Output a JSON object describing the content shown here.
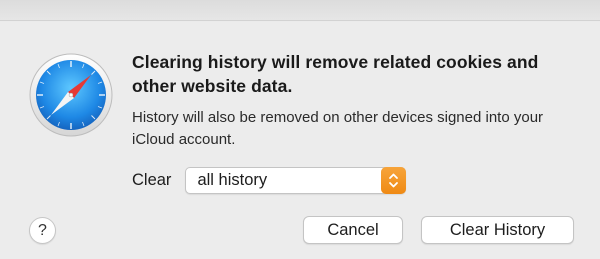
{
  "dialog": {
    "icon": "safari-compass-icon",
    "title": "Clearing history will remove related cookies and other website data.",
    "message": "History will also be removed on other devices signed into your iCloud account.",
    "clear_label": "Clear",
    "clear_select": {
      "selected": "all history"
    },
    "help_label": "?",
    "buttons": {
      "cancel": "Cancel",
      "clear_history": "Clear History"
    }
  },
  "colors": {
    "accent_stepper": "#f29419",
    "safari_blue": "#1e88e5",
    "needle_red": "#e53935"
  }
}
